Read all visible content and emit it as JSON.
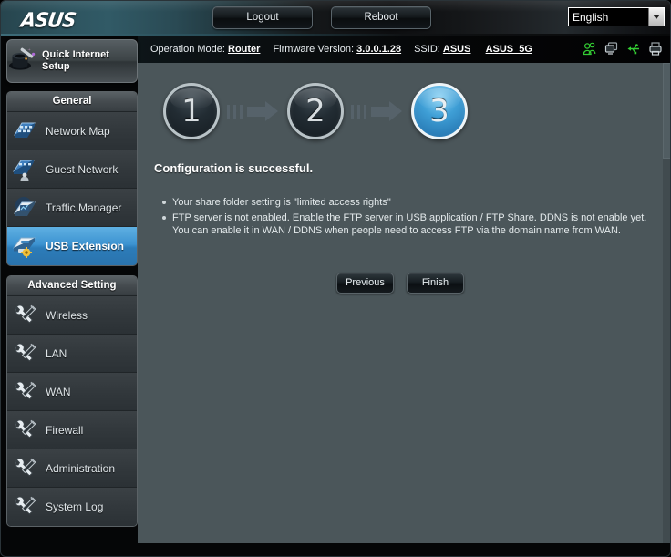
{
  "header": {
    "logo_text": "ASUS",
    "logout_label": "Logout",
    "reboot_label": "Reboot",
    "language": "English"
  },
  "infobar": {
    "operation_mode_label": "Operation Mode:",
    "operation_mode_value": "Router",
    "firmware_label": "Firmware Version:",
    "firmware_value": "3.0.0.1.28",
    "ssid_label": "SSID:",
    "ssid_24g": "ASUS",
    "ssid_5g": "ASUS_5G",
    "icons": [
      "users-icon",
      "monitor-icon",
      "usb-icon",
      "printer-icon"
    ]
  },
  "sidebar": {
    "quick_setup": {
      "line1": "Quick Internet",
      "line2": "Setup",
      "icon": "magic-hat-icon"
    },
    "general_title": "General",
    "general_items": [
      {
        "label": "Network Map",
        "icon": "network-map-icon",
        "active": false
      },
      {
        "label": "Guest Network",
        "icon": "guest-network-icon",
        "active": false
      },
      {
        "label": "Traffic Manager",
        "icon": "traffic-manager-icon",
        "active": false
      },
      {
        "label": "USB Extension",
        "icon": "usb-extension-icon",
        "active": true
      }
    ],
    "advanced_title": "Advanced Setting",
    "advanced_items": [
      {
        "label": "Wireless",
        "icon": "tools-icon"
      },
      {
        "label": "LAN",
        "icon": "tools-icon"
      },
      {
        "label": "WAN",
        "icon": "tools-icon"
      },
      {
        "label": "Firewall",
        "icon": "tools-icon"
      },
      {
        "label": "Administration",
        "icon": "tools-icon"
      },
      {
        "label": "System Log",
        "icon": "tools-icon"
      }
    ]
  },
  "main": {
    "steps": [
      {
        "number": "1",
        "active": false
      },
      {
        "number": "2",
        "active": false
      },
      {
        "number": "3",
        "active": true
      }
    ],
    "headline": "Configuration is successful.",
    "bullets": [
      "Your share folder setting is \"limited access rights\"",
      "FTP server is not enabled. Enable the FTP server in USB application / FTP Share. DDNS is not enable yet. You can enable it in WAN / DDNS when people need to access FTP via the domain name from WAN."
    ],
    "previous_label": "Previous",
    "finish_label": "Finish"
  },
  "colors": {
    "accent_blue": "#3d93d1",
    "panel_slate": "#4b565a",
    "sidebar_dark": "#32383c",
    "header_teal": "#2d535e",
    "status_green": "#33cc33"
  }
}
